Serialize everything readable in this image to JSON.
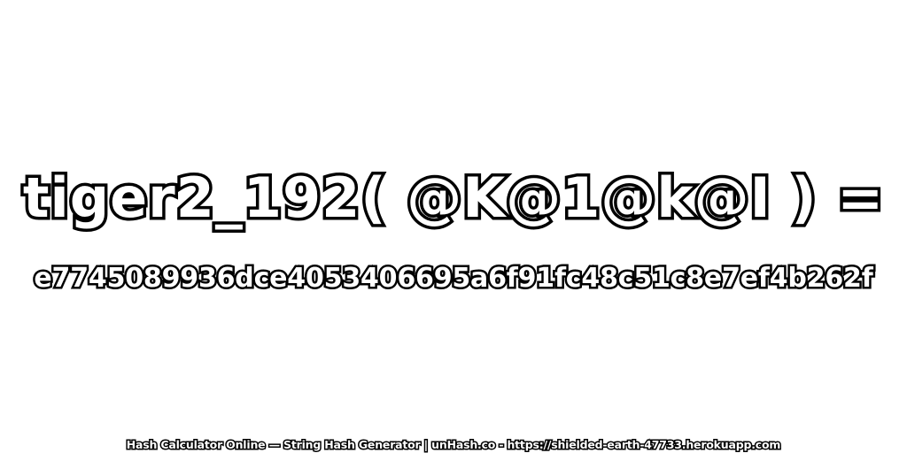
{
  "headline": "tiger2_192( @K@1@k@I ) =",
  "hash_value": "e7745089936dce4053406695a6f91fc48c51c8e7ef4b262f",
  "footer": "Hash Calculator Online — String Hash Generator | unHash.co - https://shielded-earth-47733.herokuapp.com",
  "colors": {
    "background": "#ffffff",
    "text_fill": "#ffffff",
    "text_outline": "#000000"
  }
}
